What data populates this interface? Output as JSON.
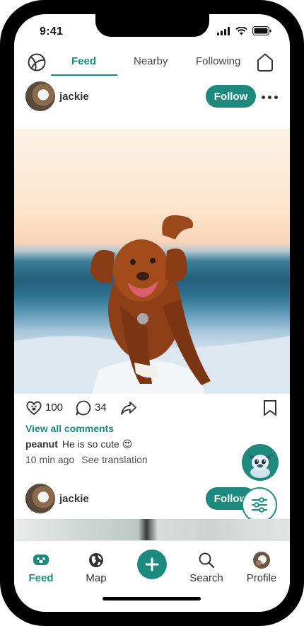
{
  "status": {
    "time": "9:41"
  },
  "topnav": {
    "tabs": [
      {
        "label": "Feed",
        "active": true
      },
      {
        "label": "Nearby",
        "active": false
      },
      {
        "label": "Following",
        "active": false
      }
    ],
    "left_icon": "sport-ball-icon",
    "right_icon": "home-outline-icon"
  },
  "posts": [
    {
      "username": "jackie",
      "follow_label": "Follow",
      "likes": "100",
      "comments": "34",
      "view_comments_label": "View all comments",
      "comment_author": "peanut",
      "comment_text": "He is so cute 😍",
      "time_ago": "10 min ago",
      "translate_label": "See translation"
    },
    {
      "username": "jackie",
      "follow_label": "Follow"
    }
  ],
  "bottom_nav": {
    "items": [
      {
        "label": "Feed",
        "icon": "paw-feed-icon",
        "active": true
      },
      {
        "label": "Map",
        "icon": "globe-icon",
        "active": false
      },
      {
        "label": "Search",
        "icon": "search-icon",
        "active": false
      },
      {
        "label": "Profile",
        "icon": "profile-avatar-icon",
        "active": false
      }
    ],
    "add_icon": "plus-icon"
  },
  "colors": {
    "accent": "#1e8a7e",
    "text": "#333333"
  }
}
